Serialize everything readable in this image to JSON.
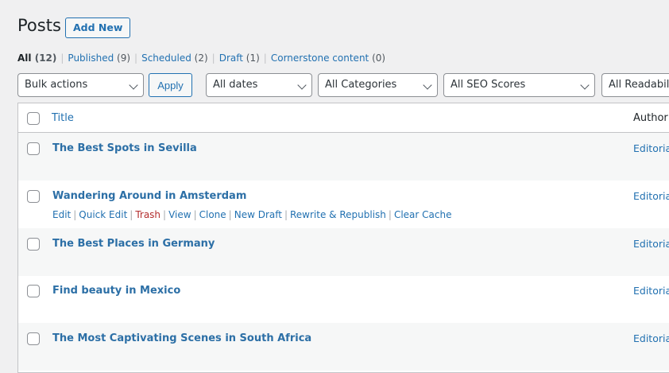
{
  "header": {
    "title": "Posts",
    "add_new_label": "Add New"
  },
  "views": [
    {
      "label": "All",
      "count": "(12)"
    },
    {
      "label": "Published",
      "count": "(9)"
    },
    {
      "label": "Scheduled",
      "count": "(2)"
    },
    {
      "label": "Draft",
      "count": "(1)"
    },
    {
      "label": "Cornerstone content",
      "count": "(0)"
    }
  ],
  "filters": {
    "bulk_actions": "Bulk actions",
    "apply_label": "Apply",
    "dates": "All dates",
    "categories": "All Categories",
    "seo_scores": "All SEO Scores",
    "readability": "All Readability Scores"
  },
  "table": {
    "columns": {
      "title": "Title",
      "author": "Author"
    },
    "rows": [
      {
        "title": "The Best Spots in Sevilla",
        "author": "Editorial"
      },
      {
        "title": "Wandering Around in Amsterdam",
        "author": "Editorial"
      },
      {
        "title": "The Best Places in Germany",
        "author": "Editorial"
      },
      {
        "title": "Find beauty in Mexico",
        "author": "Editorial"
      },
      {
        "title": "The Most Captivating Scenes in South Africa",
        "author": "Editorial"
      }
    ],
    "row_actions": {
      "edit": "Edit",
      "quick_edit": "Quick Edit",
      "trash": "Trash",
      "view": "View",
      "clone": "Clone",
      "new_draft": "New Draft",
      "rewrite": "Rewrite & Republish",
      "clear_cache": "Clear Cache"
    }
  },
  "colors": {
    "accent": "#2271b1",
    "trash": "#b32d2e",
    "background": "#f0f0f1"
  }
}
